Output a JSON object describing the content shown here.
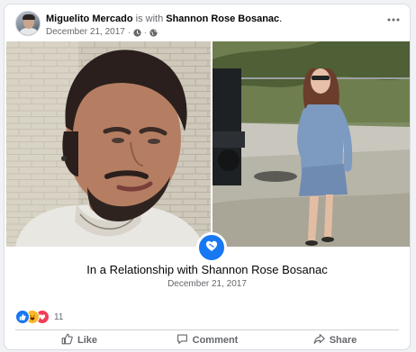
{
  "post": {
    "author": "Miguelito Mercado",
    "with_text": "is with",
    "tagged": "Shannon Rose Bosanac",
    "period": ".",
    "date": "December 21, 2017",
    "separator": "·",
    "icons": [
      "clock-icon",
      "globe-icon",
      "more-icon"
    ]
  },
  "life_event": {
    "title": "In a Relationship with Shannon Rose Bosanac",
    "date": "December 21, 2017",
    "icon": "heart-icon"
  },
  "reactions": {
    "types": [
      "like",
      "haha",
      "love"
    ],
    "count": "11",
    "colors": {
      "like": "#1877f2",
      "haha": "#f7b928",
      "love": "#f33e58"
    }
  },
  "actions": {
    "like": "Like",
    "comment": "Comment",
    "share": "Share"
  },
  "colors": {
    "accent": "#1877f2",
    "muted": "#65676b"
  }
}
